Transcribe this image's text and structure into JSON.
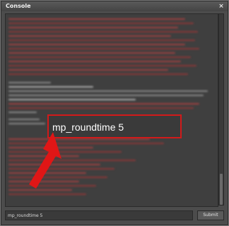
{
  "window": {
    "title": "Console",
    "close_label": "×"
  },
  "highlight": {
    "text": "mp_roundtime 5",
    "color": "#d21a1a"
  },
  "input": {
    "value": "mp_roundtime 5"
  },
  "submit": {
    "label": "Submit"
  },
  "icons": {
    "close": "close-icon",
    "annotation": "red-arrow-icon"
  }
}
